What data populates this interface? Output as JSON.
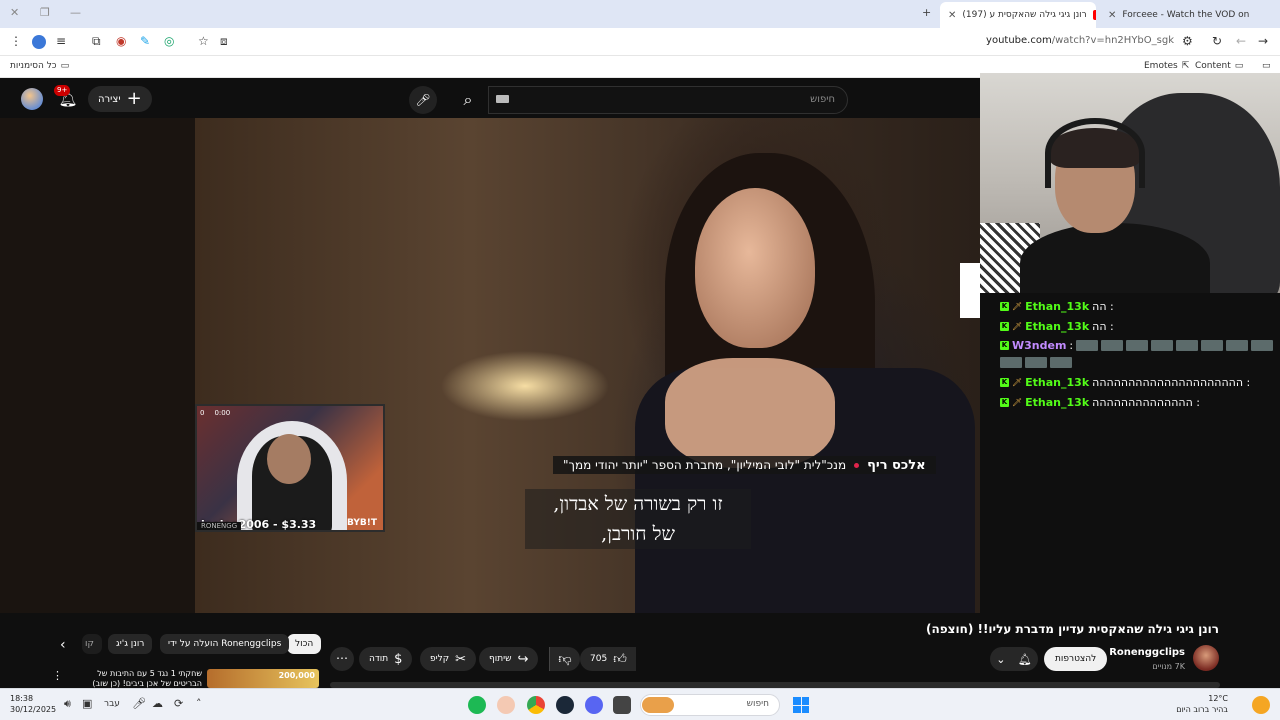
{
  "browser": {
    "tabs": [
      {
        "title": "(197) רונן גיגי גילה שהאקסית ע",
        "active": true,
        "favicon_color": "#ff0000"
      },
      {
        "title": "Forceee - Watch the VOD on K",
        "active": false,
        "favicon_color": "#53fc18"
      }
    ],
    "new_tab_icon": "plus-icon",
    "url_host": "youtube.com",
    "url_path": "/watch?v=hn2HYbO_sgk",
    "bookmarks": {
      "all_bookmarks": "כל הסימניות",
      "emotes": "Emotes",
      "content": "Content"
    }
  },
  "youtube": {
    "notifications_badge": "9+",
    "create_label": "יצירה",
    "search_placeholder": "חיפוש",
    "video": {
      "speaker_name": "אלכס ריף",
      "speaker_title": "מנכ\"לית \"לובי המיליון\", מחברת הספר \"יותר יהודי ממך\"",
      "subtitle_line1": "זו רק בשורה של אבדון,",
      "subtitle_line2": "של חורבן,"
    },
    "pip": {
      "stat_left": "0",
      "stat_timer": "0:00",
      "donation": "joejoe2006 - $3.33",
      "sponsor": "BYB!T",
      "tag": "RONENGG"
    },
    "chat": [
      {
        "user": "Ethan_13k",
        "text": "הה :",
        "color": "#53fc18"
      },
      {
        "user": "Ethan_13k",
        "text": "הה :",
        "color": "#53fc18"
      },
      {
        "user": "W3ndem",
        "text": ":",
        "color": "#c28bff"
      },
      {
        "user": "Ethan_13k",
        "text": "ההההההההההההההההההההה :",
        "color": "#53fc18"
      },
      {
        "user": "Ethan_13k",
        "text": "הההההההההההההה :",
        "color": "#53fc18"
      }
    ],
    "title": "רונן גיגי גילה שהאקסית עדיין מדברת עליו!! (חוצפה)",
    "channel": {
      "name": "Ronenggclips",
      "subscribers": "7K מנויים",
      "join_label": "להצטרפות"
    },
    "actions": {
      "likes": "705",
      "share": "שיתוף",
      "clip": "קליפ",
      "thanks": "תודה"
    },
    "chips": {
      "all": "הכול",
      "uploaded_by": "הועלה על ידי Ronenggclips",
      "ronen": "רונן ג'יג",
      "partial": "קו"
    },
    "recommendation": {
      "title_line1": "שחקתי 1 נגד 5 עם התיבות של",
      "title_line2": "הבריטים של אכן ביבים! (כן שוב)",
      "thumb_text": "200,000"
    }
  },
  "taskbar": {
    "search_placeholder": "חיפוש",
    "time": "18:38",
    "date": "30/12/2025",
    "language": "עבר",
    "temp": "12°C",
    "weather": "בהיר ברוב היום"
  }
}
